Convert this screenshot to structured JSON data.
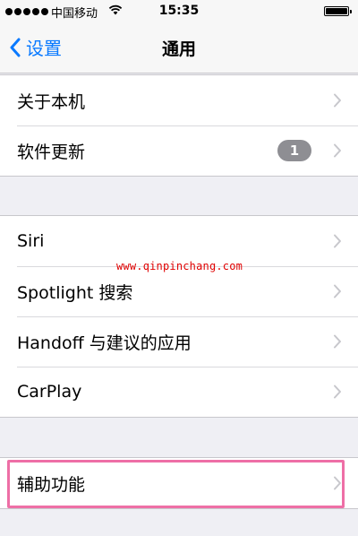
{
  "status_bar": {
    "carrier": "中国移动",
    "time": "15:35"
  },
  "nav": {
    "back_label": "设置",
    "title": "通用"
  },
  "groups": [
    {
      "rows": [
        {
          "label": "关于本机"
        },
        {
          "label": "软件更新",
          "badge": "1"
        }
      ]
    },
    {
      "rows": [
        {
          "label": "Siri"
        },
        {
          "label": "Spotlight 搜索"
        },
        {
          "label": "Handoff 与建议的应用"
        },
        {
          "label": "CarPlay"
        }
      ]
    },
    {
      "rows": [
        {
          "label": "辅助功能"
        }
      ]
    }
  ],
  "watermark": "www.qinpinchang.com",
  "colors": {
    "accent": "#0a7aff",
    "highlight": "#ee6fa6",
    "watermark": "#e00000",
    "badge": "#8e8e93"
  }
}
